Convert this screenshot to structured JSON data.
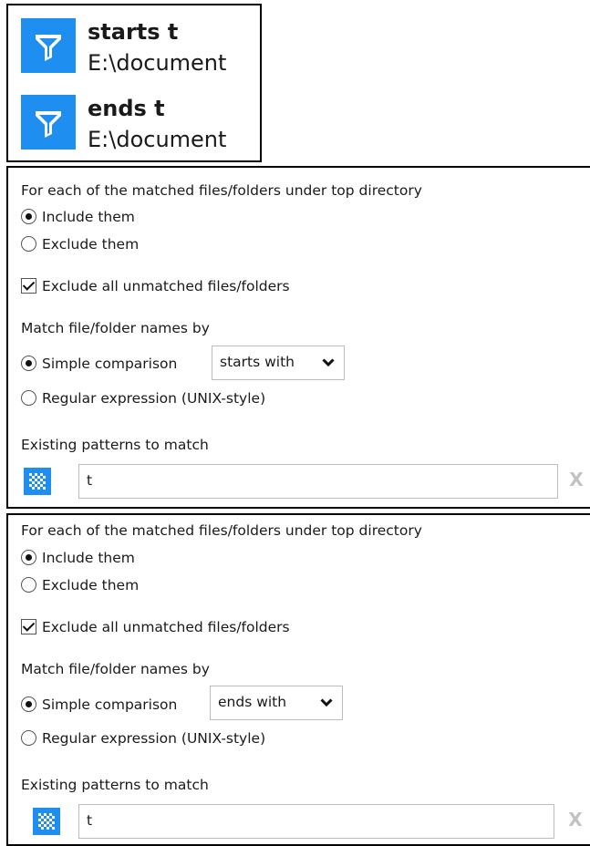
{
  "filters": [
    {
      "name": "starts t",
      "path": "E:\\document"
    },
    {
      "name": "ends t",
      "path": "E:\\document"
    }
  ],
  "panels": [
    {
      "heading": "For each of the matched files/folders under top directory",
      "include_label": "Include them",
      "exclude_label": "Exclude them",
      "exclude_unmatched_label": "Exclude all unmatched files/folders",
      "match_heading": "Match file/folder names by",
      "simple_label": "Simple comparison",
      "comparison_value": "starts with",
      "regex_label": "Regular expression (UNIX-style)",
      "patterns_heading": "Existing patterns to match",
      "pattern_value": "t",
      "remove_label": "X"
    },
    {
      "heading": "For each of the matched files/folders under top directory",
      "include_label": "Include them",
      "exclude_label": "Exclude them",
      "exclude_unmatched_label": "Exclude all unmatched files/folders",
      "match_heading": "Match file/folder names by",
      "simple_label": "Simple comparison",
      "comparison_value": "ends with",
      "regex_label": "Regular expression (UNIX-style)",
      "patterns_heading": "Existing patterns to match",
      "pattern_value": "t",
      "remove_label": "X"
    }
  ],
  "icons": {
    "filter": "funnel-icon",
    "pattern": "checkered-pattern-icon",
    "dropdown": "chevron-down-icon",
    "remove": "remove-x-icon"
  },
  "colors": {
    "accent": "#1f8ef1",
    "border": "#bdbdbd",
    "remove_disabled": "#c2c2c2"
  },
  "state": {
    "panel_1": {
      "include_selected": true,
      "exclude_unmatched_checked": true,
      "simple_selected": true
    },
    "panel_2": {
      "include_selected": true,
      "exclude_unmatched_checked": true,
      "simple_selected": true
    }
  }
}
